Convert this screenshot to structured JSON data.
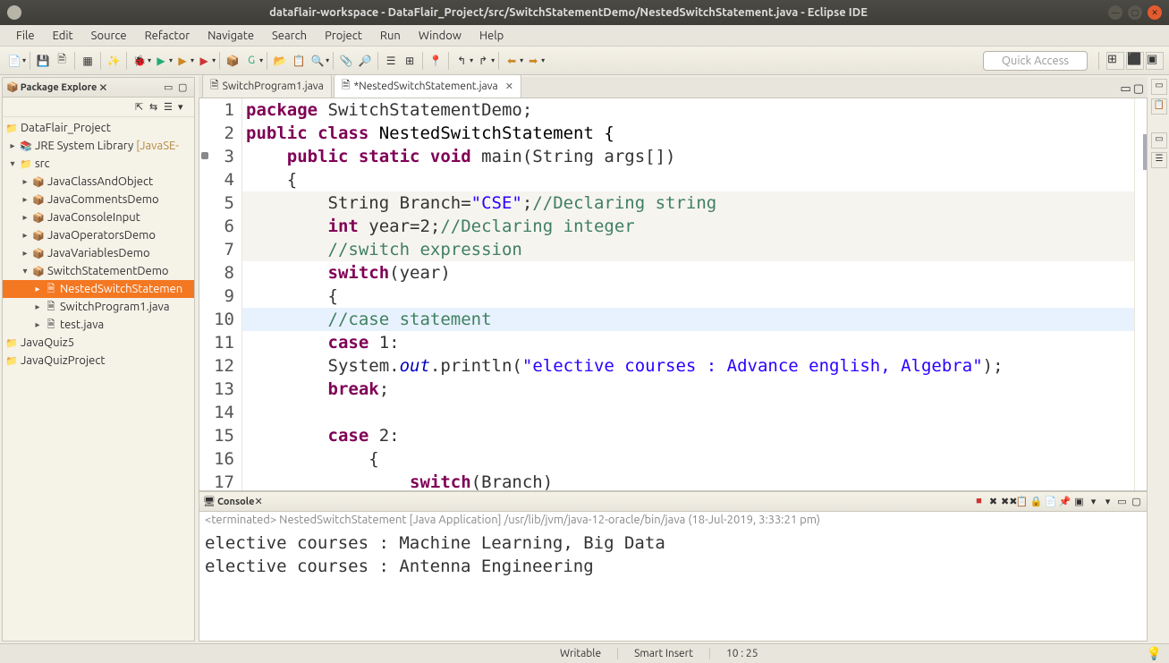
{
  "window": {
    "title": "dataflair-workspace - DataFlair_Project/src/SwitchStatementDemo/NestedSwitchStatement.java - Eclipse IDE"
  },
  "menu": {
    "items": [
      "File",
      "Edit",
      "Source",
      "Refactor",
      "Navigate",
      "Search",
      "Project",
      "Run",
      "Window",
      "Help"
    ]
  },
  "quick_access_placeholder": "Quick Access",
  "package_explorer": {
    "title": "Package Explore",
    "project": "DataFlair_Project",
    "jre": "JRE System Library",
    "jre_suffix": "[JavaSE-",
    "src": "src",
    "packages": [
      "JavaClassAndObject",
      "JavaCommentsDemo",
      "JavaConsoleInput",
      "JavaOperatorsDemo",
      "JavaVariablesDemo"
    ],
    "switch_pkg": "SwitchStatementDemo",
    "files": {
      "sel": "NestedSwitchStatemen",
      "f2": "SwitchProgram1.java",
      "f3": "test.java"
    },
    "other": [
      "JavaQuiz5",
      "JavaQuizProject"
    ]
  },
  "tabs": {
    "t1": "SwitchProgram1.java",
    "t2": "*NestedSwitchStatement.java"
  },
  "code": {
    "l1": {
      "a": "package",
      "b": " SwitchStatementDemo;"
    },
    "l2": {
      "a": "public class",
      "b": " NestedSwitchStatement {"
    },
    "l3": {
      "pad": "    ",
      "a": "public static void",
      "b": " main(String args[])"
    },
    "l4": "    {",
    "l5": {
      "pad": "        ",
      "a": "String Branch=",
      "b": "\"CSE\"",
      "c": ";",
      "d": "//Declaring string"
    },
    "l6": {
      "pad": "        ",
      "a": "int",
      "b": " year=2;",
      "c": "//Declaring integer"
    },
    "l7": {
      "pad": "        ",
      "a": "//switch expression"
    },
    "l8": {
      "pad": "        ",
      "a": "switch",
      "b": "(year)"
    },
    "l9": "        {",
    "l10": {
      "pad": "        ",
      "a": "//case statement"
    },
    "l11": {
      "pad": "        ",
      "a": "case",
      "b": " 1:"
    },
    "l12": {
      "pad": "        ",
      "a": "System.",
      "b": "out",
      "c": ".println(",
      "d": "\"elective courses : Advance english, Algebra\"",
      "e": ");"
    },
    "l13": {
      "pad": "        ",
      "a": "break",
      "b": ";"
    },
    "l14": "",
    "l15": {
      "pad": "        ",
      "a": "case",
      "b": " 2:"
    },
    "l16": "            {",
    "l17": {
      "pad": "                ",
      "a": "switch",
      "b": "(Branch)"
    }
  },
  "console": {
    "title": "Console",
    "sub": "<terminated> NestedSwitchStatement [Java Application] /usr/lib/jvm/java-12-oracle/bin/java (18-Jul-2019, 3:33:21 pm)",
    "out1": "elective courses : Machine Learning, Big Data",
    "out2": "elective courses : Antenna Engineering"
  },
  "status": {
    "writable": "Writable",
    "insert": "Smart Insert",
    "pos": "10 : 25"
  }
}
